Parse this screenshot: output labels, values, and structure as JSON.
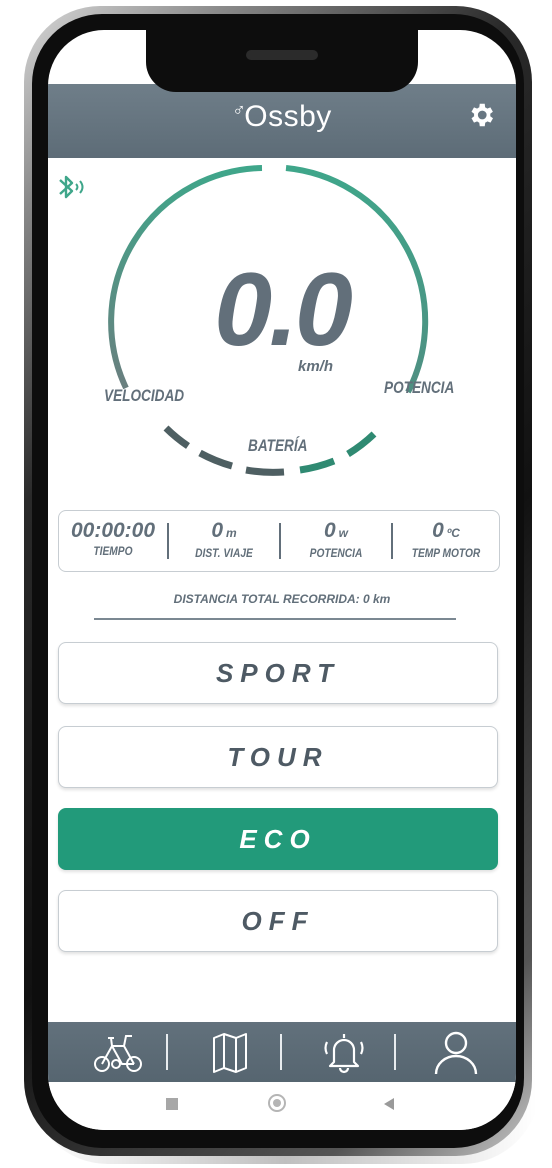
{
  "app": {
    "logo_text": "Ossby",
    "logo_mark": "♂"
  },
  "header": {
    "settings_icon": "gear-icon"
  },
  "status": {
    "bluetooth_icon": "bluetooth-icon",
    "accent_color": "#3fa68a"
  },
  "gauge": {
    "speed_value": "0.0",
    "speed_unit": "km/h",
    "label_velocidad": "VELOCIDAD",
    "label_potencia": "POTENCIA",
    "label_bateria": "BATERÍA"
  },
  "stats": [
    {
      "value": "00:00:00",
      "unit": "",
      "label": "TIEMPO"
    },
    {
      "value": "0",
      "unit": "m",
      "label": "DIST. VIAJE"
    },
    {
      "value": "0",
      "unit": "w",
      "label": "POTENCIA"
    },
    {
      "value": "0",
      "unit": "ºC",
      "label": "TEMP MOTOR"
    }
  ],
  "total_distance": "DISTANCIA TOTAL RECORRIDA: 0 km",
  "modes": [
    {
      "label": "SPORT",
      "active": false
    },
    {
      "label": "TOUR",
      "active": false
    },
    {
      "label": "ECO",
      "active": true
    },
    {
      "label": "OFF",
      "active": false
    }
  ],
  "colors": {
    "active_mode": "#229a7a",
    "header": "#6f7e89",
    "text": "#626f7a"
  },
  "bottom_nav": [
    "bike-icon",
    "map-icon",
    "bell-icon",
    "user-icon"
  ],
  "android_nav": [
    "recents-square-icon",
    "home-circle-icon",
    "back-triangle-icon"
  ]
}
